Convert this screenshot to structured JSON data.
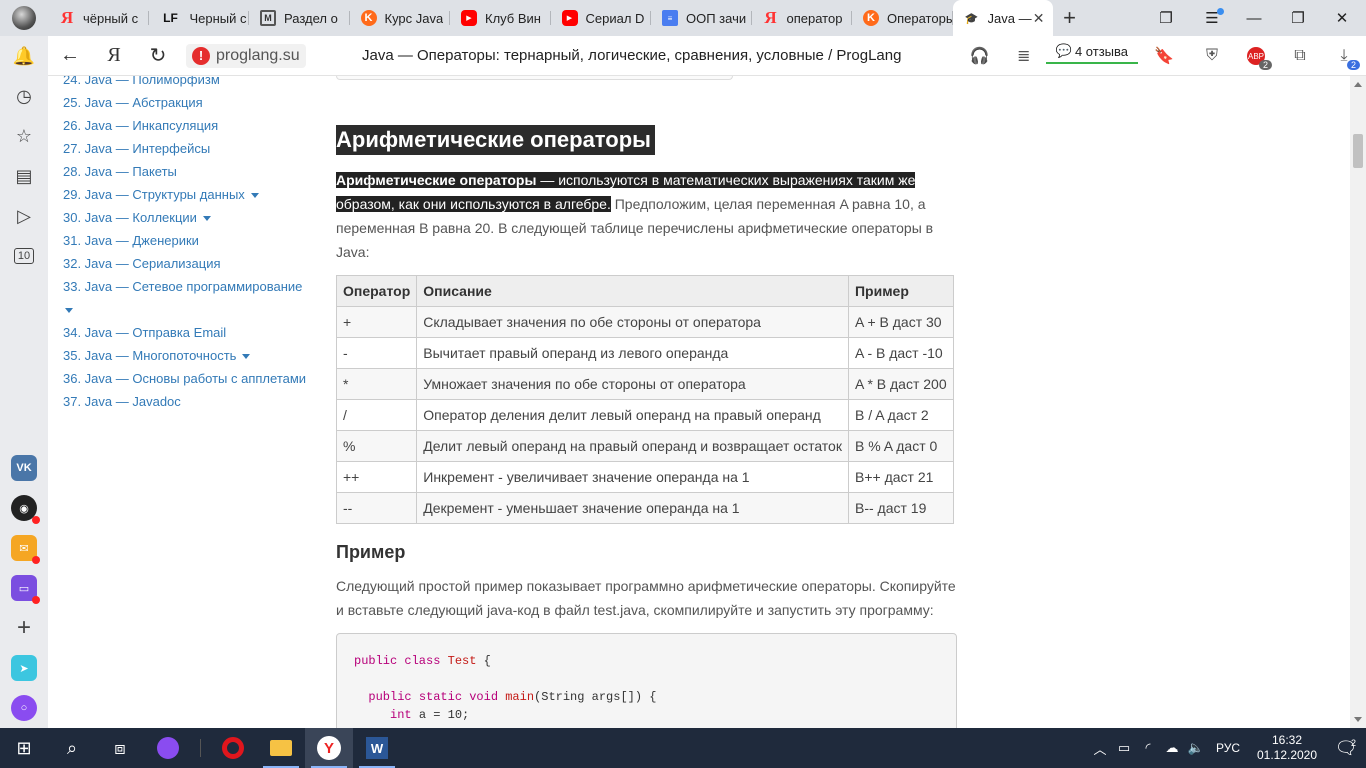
{
  "browser": {
    "tabs": [
      {
        "title": "чёрный с",
        "icon": "yandex-icon"
      },
      {
        "title": "Черный с",
        "icon": "lf-icon"
      },
      {
        "title": "Раздел о",
        "icon": "gmail-icon"
      },
      {
        "title": "Курс Java",
        "icon": "kv-icon"
      },
      {
        "title": "Клуб Вин",
        "icon": "youtube-icon"
      },
      {
        "title": "Сериал D",
        "icon": "youtube-icon"
      },
      {
        "title": "ООП зачи",
        "icon": "google-docs-icon"
      },
      {
        "title": "оператор",
        "icon": "yandex-icon"
      },
      {
        "title": "Операторы",
        "icon": "kv-icon"
      },
      {
        "title": "Java —",
        "icon": "graduation-cap-icon",
        "active": true
      }
    ],
    "new_tab": "+",
    "address": {
      "domain": "proglang.su",
      "page_title": "Java — Операторы: тернарный, логические, сравнения, условные / ProgLang"
    },
    "reviews_label": "4 отзыва",
    "yandex_letter": "Я",
    "abp_badge": "2",
    "downloads_badge": "2"
  },
  "sidebar_nav": [
    {
      "label": "24. Java — Полиморфизм",
      "caret": false
    },
    {
      "label": "25. Java — Абстракция",
      "caret": false
    },
    {
      "label": "26. Java — Инкапсуляция",
      "caret": false
    },
    {
      "label": "27. Java — Интерфейсы",
      "caret": false
    },
    {
      "label": "28. Java — Пакеты",
      "caret": false
    },
    {
      "label": "29. Java — Структуры данных",
      "caret": true
    },
    {
      "label": "30. Java — Коллекции",
      "caret": true
    },
    {
      "label": "31. Java — Дженерики",
      "caret": false
    },
    {
      "label": "32. Java — Сериализация",
      "caret": false
    },
    {
      "label": "33. Java — Сетевое программирование",
      "caret": true,
      "caret_wrap": true
    },
    {
      "label": "34. Java — Отправка Email",
      "caret": false
    },
    {
      "label": "35. Java — Многопоточность",
      "caret": true
    },
    {
      "label": "36. Java — Основы работы с апплетами",
      "caret": false
    },
    {
      "label": "37. Java — Javadoc",
      "caret": false
    }
  ],
  "article": {
    "heading": "Арифметические операторы",
    "intro_bold": "Арифметические операторы",
    "intro_highlight": " — используются в математических выражениях таким же образом, как они используются в алгебре.",
    "intro_rest": " Предположим, целая переменная A равна 10, а переменная B равна 20. В следующей таблице перечислены арифметические операторы в Java:",
    "table": {
      "headers": [
        "Оператор",
        "Описание",
        "Пример"
      ],
      "rows": [
        [
          "+",
          "Складывает значения по обе стороны от оператора",
          "A + B даст 30"
        ],
        [
          "-",
          "Вычитает правый операнд из левого операнда",
          "A - B даст -10"
        ],
        [
          "*",
          "Умножает значения по обе стороны от оператора",
          "A * B даст 200"
        ],
        [
          "/",
          "Оператор деления делит левый операнд на правый операнд",
          "B / A даст 2"
        ],
        [
          "%",
          "Делит левый операнд на правый операнд и возвращает остаток",
          "B % A даст 0"
        ],
        [
          "++",
          "Инкремент - увеличивает значение операнда на 1",
          "B++ даст 21"
        ],
        [
          "--",
          "Декремент - уменьшает значение операнда на 1",
          "B-- даст 19"
        ]
      ]
    },
    "example_heading": "Пример",
    "example_text": "Следующий простой пример показывает программно арифметические операторы. Скопируйте и вставьте следующий java-код в файл test.java, скомпилируйте и запустить эту программу:",
    "code": {
      "l1_kw": "public class",
      "l1_name": "Test",
      "l1_end": " {",
      "l2_kw": "public static void",
      "l2_fn": "main",
      "l2_end": "(String args[]) {",
      "l3_kw": "int",
      "l3_end": " a = 10;"
    }
  },
  "taskbar": {
    "lang": "РУС",
    "time": "16:32",
    "date": "01.12.2020",
    "notif_count": "2"
  },
  "colors": {
    "link": "#337ab7",
    "highlight_bg": "#222222",
    "taskbar": "#1f2a3c"
  }
}
